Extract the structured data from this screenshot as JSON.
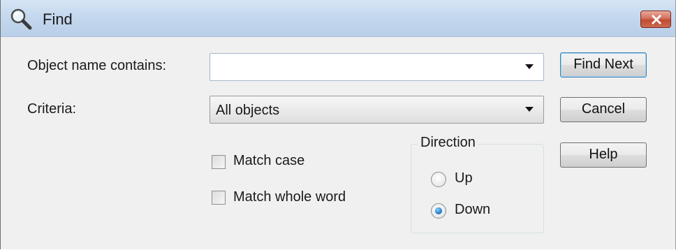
{
  "window": {
    "title": "Find",
    "close_icon": "close-x-icon",
    "title_icon": "magnifier-icon"
  },
  "form": {
    "object_name_label": "Object name contains:",
    "object_name_value": "",
    "criteria_label": "Criteria:",
    "criteria_value": "All objects",
    "match_case_label": "Match case",
    "match_case_checked": false,
    "match_whole_word_label": "Match whole word",
    "match_whole_word_checked": false,
    "direction": {
      "legend": "Direction",
      "up_label": "Up",
      "down_label": "Down",
      "selected": "Down"
    }
  },
  "buttons": {
    "find_next": "Find Next",
    "cancel": "Cancel",
    "help": "Help"
  },
  "colors": {
    "titlebar": "#c4d8ee",
    "close_button": "#c14b32",
    "dialog_bg": "#f0f0f0",
    "default_button_border": "#3c7fb1"
  }
}
